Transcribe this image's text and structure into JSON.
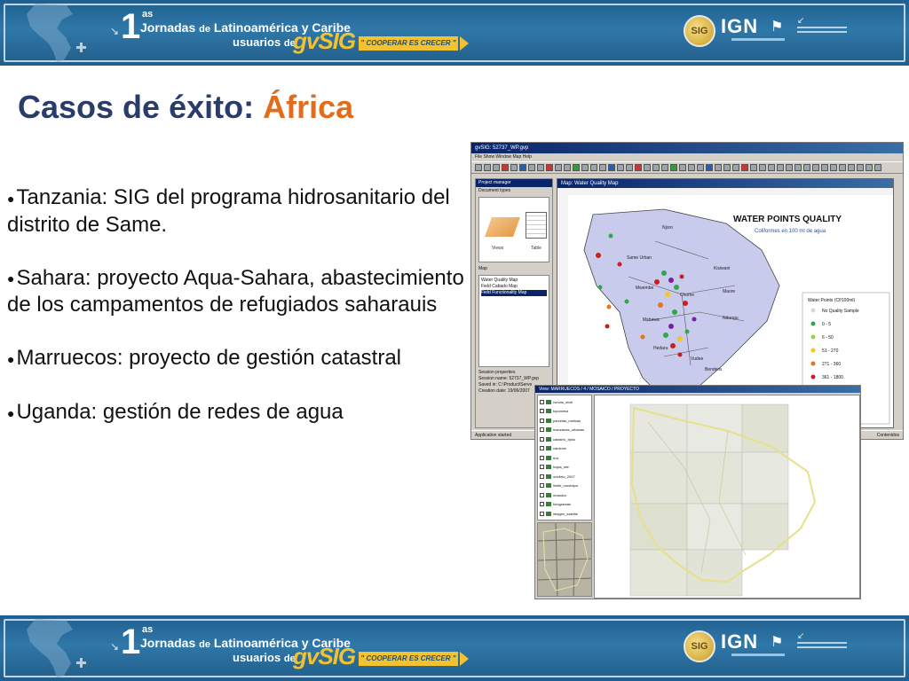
{
  "banner": {
    "number": "1",
    "superscript": "as",
    "line1_a": "Jornadas",
    "line1_b": "de",
    "line1_c": "Latinoamérica y Caribe",
    "line2_a": "usuarios",
    "line2_b": "de",
    "product": "gvSIG",
    "motto": "\" COOPERAR ES CRECER \"",
    "sig_logo": "SIG",
    "ign_logo": "IGN"
  },
  "title": {
    "main": "Casos de éxito:",
    "accent": "África"
  },
  "bullets": [
    "Tanzania: SIG del programa hidrosanitario del distrito de Same.",
    "Sahara: proyecto Aqua-Sahara, abastecimiento de los campamentos de refugiados saharauis",
    "Marruecos: proyecto de gestión catastral",
    "Uganda: gestión de redes de agua"
  ],
  "screenshot1": {
    "window_title": "gvSIG: 52737_WP.gvp",
    "menu": "File   Show   Window   Map   Help",
    "panel_title": "Project manager",
    "document_types": "Document types",
    "doc_label_views": "Views",
    "doc_label_table": "Table",
    "maps_label": "Map",
    "maps": [
      "Water Quality Map",
      "Field Cabado Map",
      "Field Functionality Map"
    ],
    "maps_selected_index": 2,
    "session_title": "Session properties",
    "session": [
      "Session name:  52737_WP.gvp",
      "Saved in:  C:\\Product\\Serve",
      "Creation date:  19/06/2007"
    ],
    "map_window_title": "Map: Water Quality Map",
    "map_title": "WATER POINTS QUALITY",
    "map_subtitle": "Coliformes en 100 ml de agua",
    "legend_title": "Water Points (Cf/100ml)",
    "legend": [
      {
        "label": "No Quality Sample",
        "color": "#d8d8d8"
      },
      {
        "label": "0 - 5",
        "color": "#2fa84a"
      },
      {
        "label": "6 - 50",
        "color": "#9bd13a"
      },
      {
        "label": "51 - 270",
        "color": "#f5c623"
      },
      {
        "label": "271 - 360",
        "color": "#e8731e"
      },
      {
        "label": "361 - 1800",
        "color": "#c81e1e"
      },
      {
        "label": "> 1800",
        "color": "#7a1ea0"
      },
      {
        "label": "No Data",
        "color": "#111111"
      }
    ],
    "places": [
      "Njoro",
      "Same Urban",
      "Kisiwani",
      "Mwembe",
      "Chome",
      "Maore",
      "Ndungu",
      "Mshewa",
      "Hedaru",
      "Vudee",
      "Bendera"
    ],
    "status_left": "Application started",
    "status_right": "Contenidos"
  },
  "screenshot2": {
    "window_title": "View: MARRUECOS / 4 / MOSAICO / PROYECTO",
    "layers": [
      {
        "label": "curvas_nivel",
        "color": "#3a7d3a"
      },
      {
        "label": "toponimia",
        "color": "#3a7d3a"
      },
      {
        "label": "parcelas_rusticas",
        "color": "#3a7d3a"
      },
      {
        "label": "manzanas_urbanas",
        "color": "#3a7d3a"
      },
      {
        "label": "catastro_ejido",
        "color": "#3a7d3a"
      },
      {
        "label": "caminos",
        "color": "#3a7d3a"
      },
      {
        "label": "rios",
        "color": "#3a7d3a"
      },
      {
        "label": "hojas_mtn",
        "color": "#3a7d3a"
      },
      {
        "label": "ortofoto_2007",
        "color": "#3a7d3a"
      },
      {
        "label": "limite_municipal",
        "color": "#3a7d3a"
      },
      {
        "label": "mosaico",
        "color": "#3a7d3a"
      },
      {
        "label": "fotogramas",
        "color": "#3a7d3a"
      },
      {
        "label": "imagen_satelite",
        "color": "#3a7d3a"
      }
    ]
  }
}
